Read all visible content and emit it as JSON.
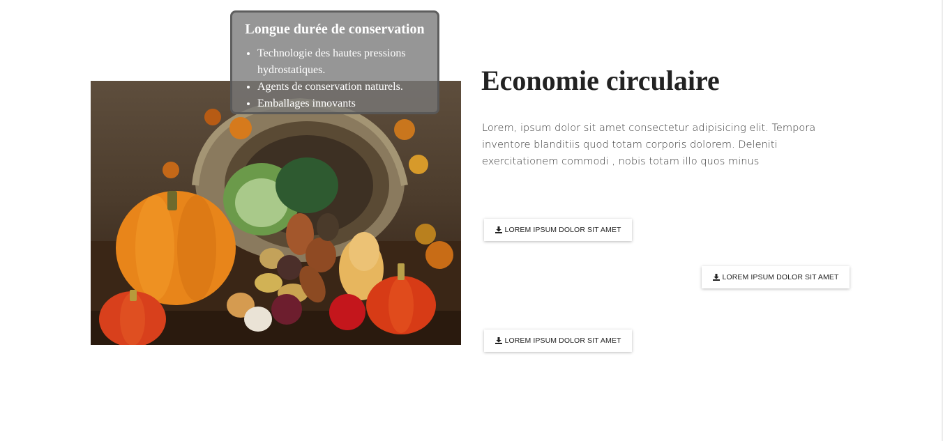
{
  "tooltip": {
    "title": "Longue durée de conservation",
    "items": [
      "Technologie des hautes pressions hydrostatiques.",
      "Agents de conservation naturels.",
      "Emballages innovants"
    ]
  },
  "section": {
    "heading": "Economie circulaire",
    "description": "Lorem, ipsum dolor sit amet consectetur adipisicing elit. Tempora inventore blanditiis quod totam corporis dolorem. Deleniti exercitationem commodi , nobis totam illo quos minus"
  },
  "buttons": [
    {
      "label": "LOREM IPSUM DOLOR SIT AMET",
      "icon": "download-icon"
    },
    {
      "label": "LOREM IPSUM DOLOR SIT AMET",
      "icon": "download-icon"
    },
    {
      "label": "LOREM IPSUM DOLOR SIT AMET",
      "icon": "download-icon"
    }
  ],
  "image": {
    "subject": "vegetables-basket-photo"
  },
  "colors": {
    "text": "#222222",
    "tooltip_bg": "#787878",
    "pumpkin": "#e8851a"
  }
}
